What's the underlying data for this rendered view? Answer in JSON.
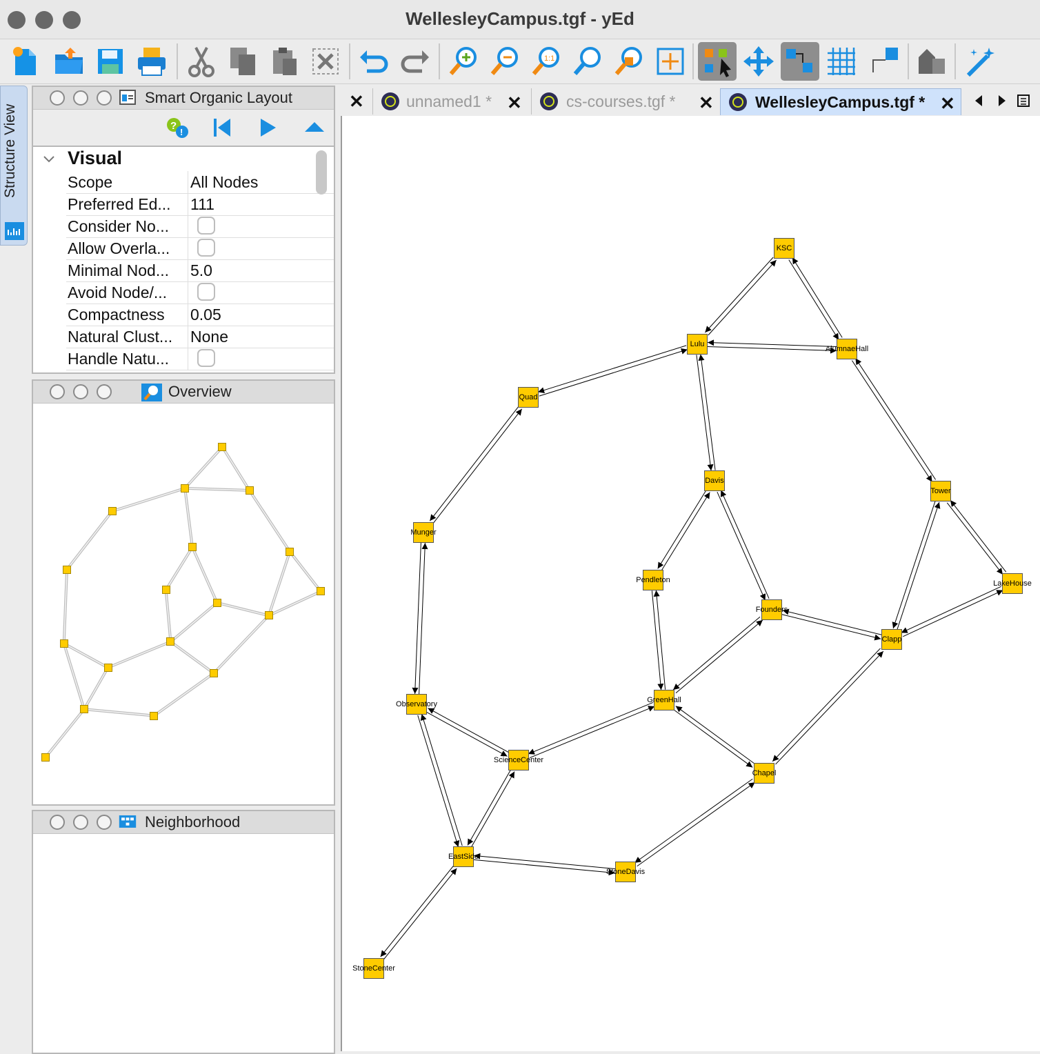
{
  "window": {
    "title": "WellesleyCampus.tgf - yEd"
  },
  "toolbar": {
    "buttons": [
      "new-document",
      "open-document",
      "save-document",
      "print",
      "cut",
      "copy",
      "paste",
      "delete",
      "undo",
      "redo",
      "zoom-in",
      "zoom-out",
      "zoom-1-1",
      "zoom-fit",
      "zoom-selection",
      "fit-content",
      "edit-mode",
      "move-mode",
      "orthogonal-mode",
      "grid",
      "snap-lines",
      "layout",
      "magic-wand"
    ],
    "active": [
      "edit-mode",
      "orthogonal-mode"
    ]
  },
  "structure_view": {
    "label": "Structure View"
  },
  "layout_panel": {
    "title": "Smart Organic Layout",
    "section": "Visual",
    "rows": [
      {
        "key": "Scope",
        "value": "All Nodes",
        "checkbox": false
      },
      {
        "key": "Preferred Ed...",
        "value": "111",
        "checkbox": false
      },
      {
        "key": "Consider No...",
        "value": "",
        "checkbox": true
      },
      {
        "key": "Allow Overla...",
        "value": "",
        "checkbox": true
      },
      {
        "key": "Minimal Nod...",
        "value": "5.0",
        "checkbox": false
      },
      {
        "key": "Avoid Node/...",
        "value": "",
        "checkbox": true
      },
      {
        "key": "Compactness",
        "value": "0.05",
        "checkbox": false
      },
      {
        "key": "Natural Clust...",
        "value": "None",
        "checkbox": false
      },
      {
        "key": "Handle Natu...",
        "value": "",
        "checkbox": true
      }
    ]
  },
  "overview_panel": {
    "title": "Overview"
  },
  "neighborhood_panel": {
    "title": "Neighborhood"
  },
  "tabs": [
    {
      "label": "unnamed1 *",
      "active": false
    },
    {
      "label": "cs-courses.tgf *",
      "active": false
    },
    {
      "label": "WellesleyCampus.tgf  *",
      "active": true
    }
  ],
  "graph": {
    "node_color": "#ffcc00",
    "nodes": [
      {
        "id": "KSC",
        "label": "KSC"
      },
      {
        "id": "Lulu",
        "label": "Lulu"
      },
      {
        "id": "AlumnaeHall",
        "label": "AlumnaeHall"
      },
      {
        "id": "Quad",
        "label": "Quad"
      },
      {
        "id": "Davis",
        "label": "Davis"
      },
      {
        "id": "Tower",
        "label": "Tower"
      },
      {
        "id": "Munger",
        "label": "Munger"
      },
      {
        "id": "Pendleton",
        "label": "Pendleton"
      },
      {
        "id": "Founders",
        "label": "Founders"
      },
      {
        "id": "LakeHouse",
        "label": "LakeHouse"
      },
      {
        "id": "Clapp",
        "label": "Clapp"
      },
      {
        "id": "Observatory",
        "label": "Observatory"
      },
      {
        "id": "GreenHall",
        "label": "GreenHall"
      },
      {
        "id": "ScienceCenter",
        "label": "ScienceCenter"
      },
      {
        "id": "Chapel",
        "label": "Chapel"
      },
      {
        "id": "EastSide",
        "label": "EastSide"
      },
      {
        "id": "StoneDavis",
        "label": "StoneDavis"
      },
      {
        "id": "StoneCenter",
        "label": "StoneCenter"
      }
    ],
    "edges": [
      [
        "KSC",
        "Lulu"
      ],
      [
        "KSC",
        "AlumnaeHall"
      ],
      [
        "Lulu",
        "AlumnaeHall"
      ],
      [
        "Lulu",
        "Quad"
      ],
      [
        "Lulu",
        "Davis"
      ],
      [
        "AlumnaeHall",
        "Tower"
      ],
      [
        "Quad",
        "Munger"
      ],
      [
        "Davis",
        "Pendleton"
      ],
      [
        "Davis",
        "Founders"
      ],
      [
        "Tower",
        "LakeHouse"
      ],
      [
        "Tower",
        "Clapp"
      ],
      [
        "LakeHouse",
        "Clapp"
      ],
      [
        "Founders",
        "Clapp"
      ],
      [
        "Founders",
        "GreenHall"
      ],
      [
        "Pendleton",
        "GreenHall"
      ],
      [
        "Munger",
        "Observatory"
      ],
      [
        "Observatory",
        "ScienceCenter"
      ],
      [
        "Observatory",
        "EastSide"
      ],
      [
        "GreenHall",
        "ScienceCenter"
      ],
      [
        "GreenHall",
        "Chapel"
      ],
      [
        "Clapp",
        "Chapel"
      ],
      [
        "ScienceCenter",
        "EastSide"
      ],
      [
        "EastSide",
        "StoneDavis"
      ],
      [
        "Chapel",
        "StoneDavis"
      ],
      [
        "EastSide",
        "StoneCenter"
      ]
    ]
  }
}
